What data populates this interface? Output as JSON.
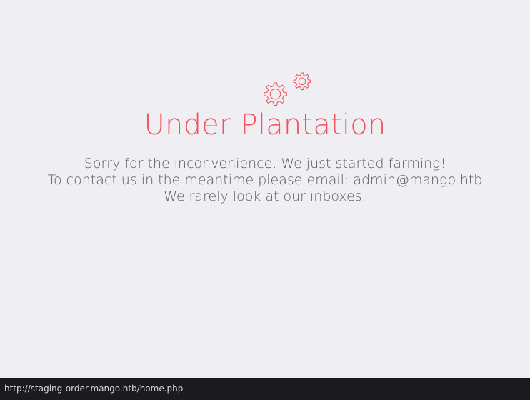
{
  "main": {
    "title": "Under Plantation",
    "message_line_1": "Sorry for the inconvenience. We just started farming!",
    "message_line_2": "To contact us in the meantime please email: admin@mango.htb",
    "message_line_3": "We rarely look at our inboxes.",
    "icon": "gears-icon"
  },
  "status_bar": {
    "url": "http://staging-order.mango.htb/home.php"
  },
  "colors": {
    "background": "#efeef3",
    "accent": "#f2545b",
    "text": "#5b5c67",
    "status_bar": "#1b1b1d"
  }
}
